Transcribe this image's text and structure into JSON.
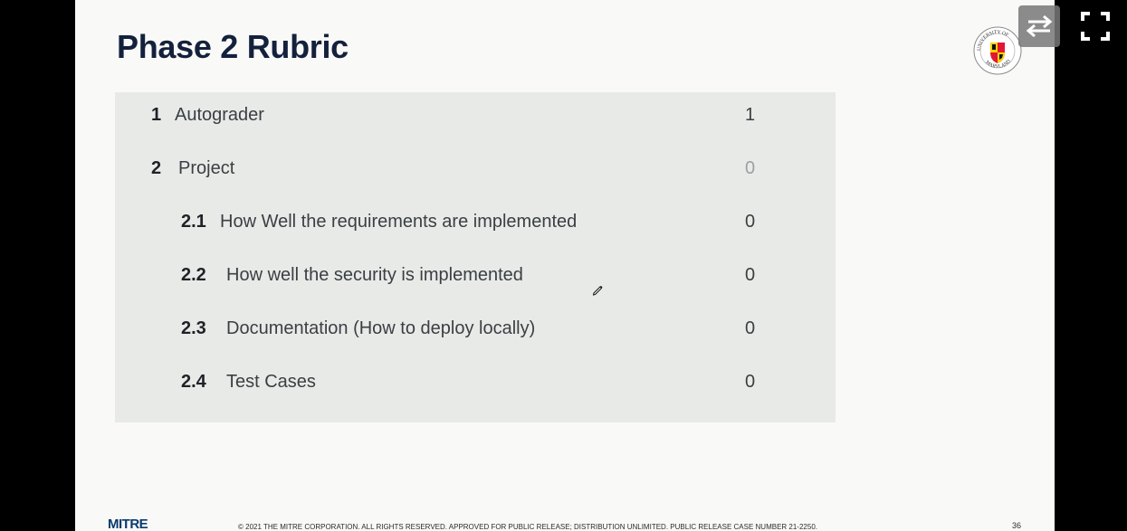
{
  "slide": {
    "title": "Phase 2 Rubric",
    "rows": [
      {
        "number": "1",
        "label": "Autograder",
        "score": "1"
      },
      {
        "number": "2",
        "label": "Project",
        "score": "0"
      },
      {
        "number": "2.1",
        "label": "How Well the requirements are implemented",
        "score": "0"
      },
      {
        "number": "2.2",
        "label": "How well the security is implemented",
        "score": "0"
      },
      {
        "number": "2.3",
        "label": "Documentation (How to deploy locally)",
        "score": "0"
      },
      {
        "number": "2.4",
        "label": "Test Cases",
        "score": "0"
      }
    ],
    "footer": {
      "brand": "MITRE",
      "notice": "© 2021 THE MITRE CORPORATION. ALL RIGHTS RESERVED. APPROVED FOR PUBLIC RELEASE; DISTRIBUTION UNLIMITED. PUBLIC RELEASE CASE NUMBER 21-2250.",
      "page_number": "36"
    },
    "logo": {
      "text": "UNIVERSITY OF MARYLAND",
      "icon": "university-seal-icon"
    }
  },
  "controls": {
    "swap_icon": "swap-arrows-icon",
    "fullscreen_icon": "fullscreen-icon"
  },
  "colors": {
    "title": "#14213d",
    "table_bg": "#e8eae7",
    "slide_bg": "#f9f9f7",
    "brand_blue": "#0b3a6e"
  }
}
